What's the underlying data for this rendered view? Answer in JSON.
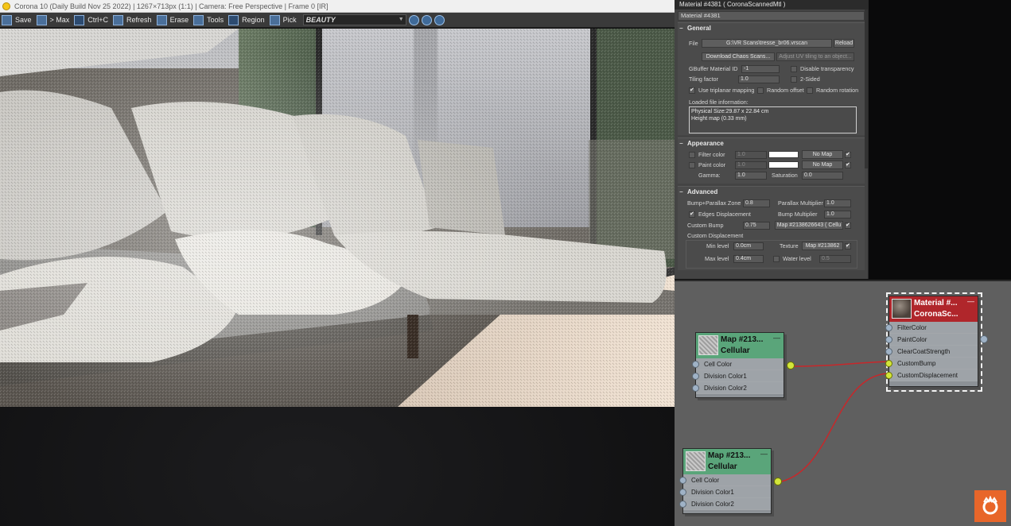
{
  "vfb": {
    "title": "Corona 10 (Daily Build Nov 25 2022) | 1267×713px (1:1) | Camera: Free Perspective | Frame 0 [IR]",
    "toolbar": {
      "save": "Save",
      "to_max": "> Max",
      "copy": "Ctrl+C",
      "refresh": "Refresh",
      "erase": "Erase",
      "tools": "Tools",
      "region": "Region",
      "pick": "Pick",
      "pass": "BEAUTY"
    }
  },
  "material": {
    "title": "Material #4381  ( CoronaScannedMtl )",
    "name": "Material #4381",
    "general": {
      "header": "General",
      "file_label": "File",
      "file_value": "G:\\VR Scans\\tresse_br06.vrscan",
      "reload": "Reload",
      "download": "Download Chaos Scans...",
      "adjust_uv": "Adjust UV tiling to an object...",
      "gbuffer_label": "GBuffer Material ID",
      "gbuffer_value": "-1",
      "disable_transparency": "Disable transparency",
      "tiling_label": "Tiling factor",
      "tiling_value": "1.0",
      "two_sided": "2-Sided",
      "use_triplanar": "Use triplanar mapping",
      "random_offset": "Random offset",
      "random_rotation": "Random rotation",
      "loaded_info_label": "Loaded file information:",
      "physical_size": "Physical Size:29.87 x 22.84 cm",
      "height_map": "Height map (0.33 mm)"
    },
    "appearance": {
      "header": "Appearance",
      "filter_color": "Filter color",
      "filter_value": "1.0",
      "paint_color": "Paint color",
      "paint_value": "1.0",
      "no_map_1": "No Map",
      "no_map_2": "No Map",
      "gamma_label": "Gamma:",
      "gamma_value": "1.0",
      "saturation_label": "Saturation",
      "saturation_value": "0.0"
    },
    "advanced": {
      "header": "Advanced",
      "bump_parallax_label": "Bump+Parallax Zone",
      "bump_parallax_value": "0.8",
      "parallax_mult_label": "Parallax Multiplier",
      "parallax_mult_value": "1.0",
      "edges_disp": "Edges Displacement",
      "bump_mult_label": "Bump Multiplier",
      "bump_mult_value": "1.0",
      "custom_bump_label": "Custom Bump",
      "custom_bump_value": "0.75",
      "custom_bump_map": "Map #2138626643  ( Cellu",
      "custom_disp_label": "Custom Displacement",
      "min_level_label": "Min level",
      "min_level_value": "0.0cm",
      "texture_label": "Texture",
      "texture_map": "Map #213862",
      "max_level_label": "Max level",
      "max_level_value": "0.4cm",
      "water_level_label": "Water level",
      "water_level_value": "0.5"
    }
  },
  "slate": {
    "material_node": {
      "title1": "Material #...",
      "title2": "CoronaSc...",
      "slots": [
        "FilterColor",
        "PaintColor",
        "ClearCoatStrength",
        "CustomBump",
        "CustomDisplacement"
      ]
    },
    "cellular_node_1": {
      "title1": "Map #213...",
      "title2": "Cellular",
      "slots": [
        "Cell Color",
        "Division Color1",
        "Division Color2"
      ]
    },
    "cellular_node_2": {
      "title1": "Map #213...",
      "title2": "Cellular",
      "slots": [
        "Cell Color",
        "Division Color1",
        "Division Color2"
      ]
    }
  },
  "colors": {
    "accent": "#e8662a",
    "node_green": "#5aa57a",
    "node_red": "#b0262b",
    "wire": "#c8272a"
  }
}
